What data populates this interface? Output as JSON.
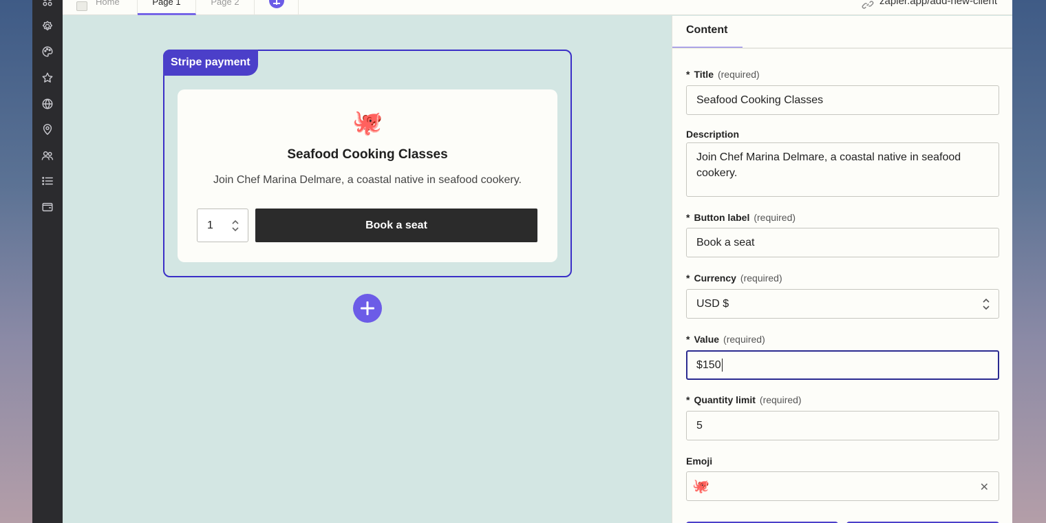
{
  "tabs": {
    "home": "Home",
    "page1": "Page 1",
    "page2": "Page 2"
  },
  "url": "zapier.app/add-new-client",
  "block": {
    "label": "Stripe payment",
    "card": {
      "emoji": "🐙",
      "title": "Seafood Cooking Classes",
      "description": "Join Chef Marina Delmare, a coastal native in seafood cookery.",
      "quantity": "1",
      "button_label": "Book a seat"
    }
  },
  "panel": {
    "tab": "Content",
    "required_text": "(required)",
    "star": "*",
    "title_label": "Title",
    "title_value": "Seafood Cooking Classes",
    "description_label": "Description",
    "description_value": "Join Chef Marina Delmare, a coastal native in seafood cookery.",
    "button_label_label": "Button label",
    "button_label_value": "Book a seat",
    "currency_label": "Currency",
    "currency_value": "USD $",
    "value_label": "Value",
    "value_value": "$150",
    "quantity_label": "Quantity limit",
    "quantity_value": "5",
    "emoji_label": "Emoji",
    "emoji_value": "🐙",
    "clear_glyph": "✕"
  },
  "colors": {
    "accent": "#6c5ce7",
    "block_border": "#3a2fc7",
    "canvas": "#d3e6e3",
    "rail": "#2b2b2e"
  }
}
